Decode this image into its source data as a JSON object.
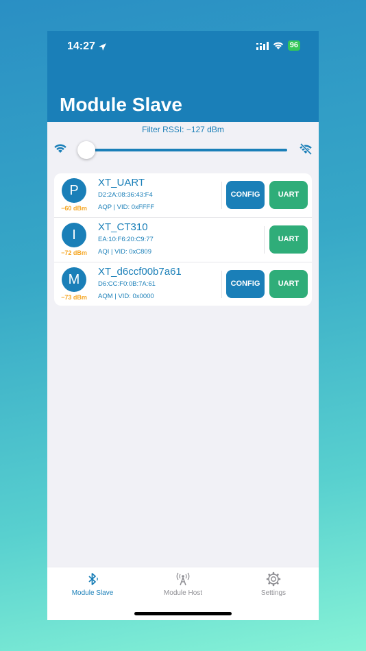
{
  "status": {
    "time": "14:27",
    "battery": "96"
  },
  "header": {
    "title": "Module Slave"
  },
  "filter": {
    "label": "Filter RSSI: −127 dBm",
    "slider_value_fraction": 0.0
  },
  "devices": [
    {
      "initial": "P",
      "rssi": "−60 dBm",
      "name": "XT_UART",
      "mac": "D2:2A:08:36:43:F4",
      "info": "AQP | VID: 0xFFFF",
      "config_label": "CONFIG",
      "uart_label": "UART"
    },
    {
      "initial": "I",
      "rssi": "−72 dBm",
      "name": "XT_CT310",
      "mac": "EA:10:F6:20:C9:77",
      "info": "AQI | VID: 0xC809",
      "uart_label": "UART"
    },
    {
      "initial": "M",
      "rssi": "−73 dBm",
      "name": "XT_d6ccf00b7a61",
      "mac": "D6:CC:F0:0B:7A:61",
      "info": "AQM | VID: 0x0000",
      "config_label": "CONFIG",
      "uart_label": "UART"
    }
  ],
  "tabs": [
    {
      "label": "Module Slave",
      "icon": "bluetooth-icon",
      "active": true
    },
    {
      "label": "Module Host",
      "icon": "antenna-icon",
      "active": false
    },
    {
      "label": "Settings",
      "icon": "gear-icon",
      "active": false
    }
  ],
  "colors": {
    "primary": "#1a7fb8",
    "uart": "#2fad79",
    "rssi": "#f5a623",
    "battery": "#34c759"
  }
}
